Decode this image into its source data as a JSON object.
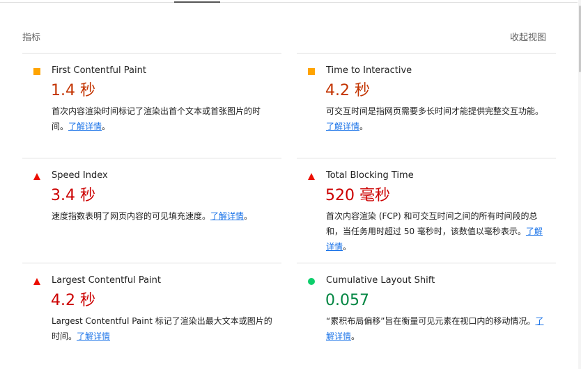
{
  "header": {
    "title": "指标",
    "toggle_label": "收起视图"
  },
  "colors": {
    "average": "#ffa400",
    "fail": "#eb0f00",
    "pass": "#0cce6b",
    "link": "#1a73e8"
  },
  "metrics": [
    {
      "name": "First Contentful Paint",
      "value": "1.4 秒",
      "status": "average",
      "indicator_icon": "orange-square-icon",
      "desc": "首次内容渲染时间标记了渲染出首个文本或首张图片的时间。",
      "link": "了解详情",
      "suffix": "。"
    },
    {
      "name": "Time to Interactive",
      "value": "4.2 秒",
      "status": "average",
      "indicator_icon": "orange-square-icon",
      "desc": "可交互时间是指网页需要多长时间才能提供完整交互功能。",
      "link": "了解详情",
      "suffix": "。"
    },
    {
      "name": "Speed Index",
      "value": "3.4 秒",
      "status": "fail",
      "indicator_icon": "red-triangle-icon",
      "desc": "速度指数表明了网页内容的可见填充速度。",
      "link": "了解详情",
      "suffix": "。"
    },
    {
      "name": "Total Blocking Time",
      "value": "520 毫秒",
      "status": "fail",
      "indicator_icon": "red-triangle-icon",
      "desc": "首次内容渲染 (FCP) 和可交互时间之间的所有时间段的总和，当任务用时超过 50 毫秒时，该数值以毫秒表示。",
      "link": "了解详情",
      "suffix": "。"
    },
    {
      "name": "Largest Contentful Paint",
      "value": "4.2 秒",
      "status": "fail",
      "indicator_icon": "red-triangle-icon",
      "desc": "Largest Contentful Paint 标记了渲染出最大文本或图片的时间。",
      "link": "了解详情",
      "suffix": ""
    },
    {
      "name": "Cumulative Layout Shift",
      "value": "0.057",
      "status": "pass",
      "indicator_icon": "green-circle-icon",
      "desc": "“累积布局偏移”旨在衡量可见元素在视口内的移动情况。",
      "link": "了解详情",
      "suffix": "。"
    }
  ]
}
